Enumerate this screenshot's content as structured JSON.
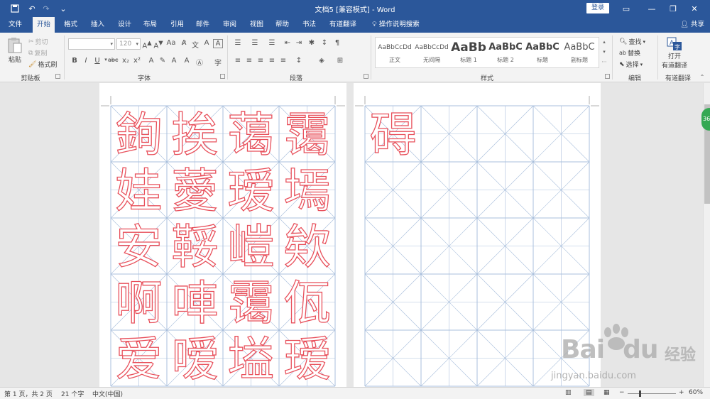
{
  "titlebar": {
    "title": "文档5 [兼容模式] - Word",
    "signin": "登录",
    "qa_icons": [
      "save-icon",
      "undo-icon",
      "redo-icon",
      "customize-icon"
    ]
  },
  "tabs": [
    "文件",
    "开始",
    "格式",
    "插入",
    "设计",
    "布局",
    "引用",
    "邮件",
    "审阅",
    "视图",
    "帮助",
    "书法",
    "有道翻译",
    "操作说明搜索"
  ],
  "share_label": "共享",
  "ribbon": {
    "clipboard": {
      "paste": "粘贴",
      "cut": "剪切",
      "copy": "复制",
      "format_painter": "格式刷",
      "label": "剪贴板"
    },
    "font": {
      "name_value": "",
      "size_value": "120",
      "label": "字体"
    },
    "paragraph": {
      "label": "段落"
    },
    "styles": {
      "items": [
        {
          "preview": "AaBbCcDd",
          "name": "正文"
        },
        {
          "preview": "AaBbCcDd",
          "name": "无间隔"
        },
        {
          "preview": "AaBb",
          "name": "标题 1"
        },
        {
          "preview": "AaBbC",
          "name": "标题 2"
        },
        {
          "preview": "AaBbC",
          "name": "标题"
        },
        {
          "preview": "AaBbC",
          "name": "副标题"
        }
      ],
      "label": "样式"
    },
    "editing": {
      "find": "查找",
      "replace": "替换",
      "select": "选择",
      "label": "编辑"
    },
    "youdao": {
      "open": "打开",
      "translate": "有道翻译",
      "label": "有道翻译"
    }
  },
  "page1_chars": [
    "銁",
    "挨",
    "蔼",
    "霭",
    "娃",
    "薆",
    "瑷",
    "墕",
    "安",
    "鞖",
    "嵦",
    "欸",
    "啊",
    "唓",
    "霭",
    "佤",
    "爱",
    "嗳",
    "塧",
    "瑷"
  ],
  "page2_chars": [
    "碍"
  ],
  "colors": {
    "accent": "#2b579a",
    "glyph": "#e8505b",
    "grid": "#a9bfdc"
  },
  "badge_text": "36",
  "status": {
    "page": "第 1 页，共 2 页",
    "words": "21 个字",
    "lang": "中文(中国)",
    "zoom": "60%"
  },
  "watermark": {
    "brand": "Bai",
    "brand2": "du",
    "jingyan": "经验",
    "url": "jingyan.baidu.com"
  }
}
